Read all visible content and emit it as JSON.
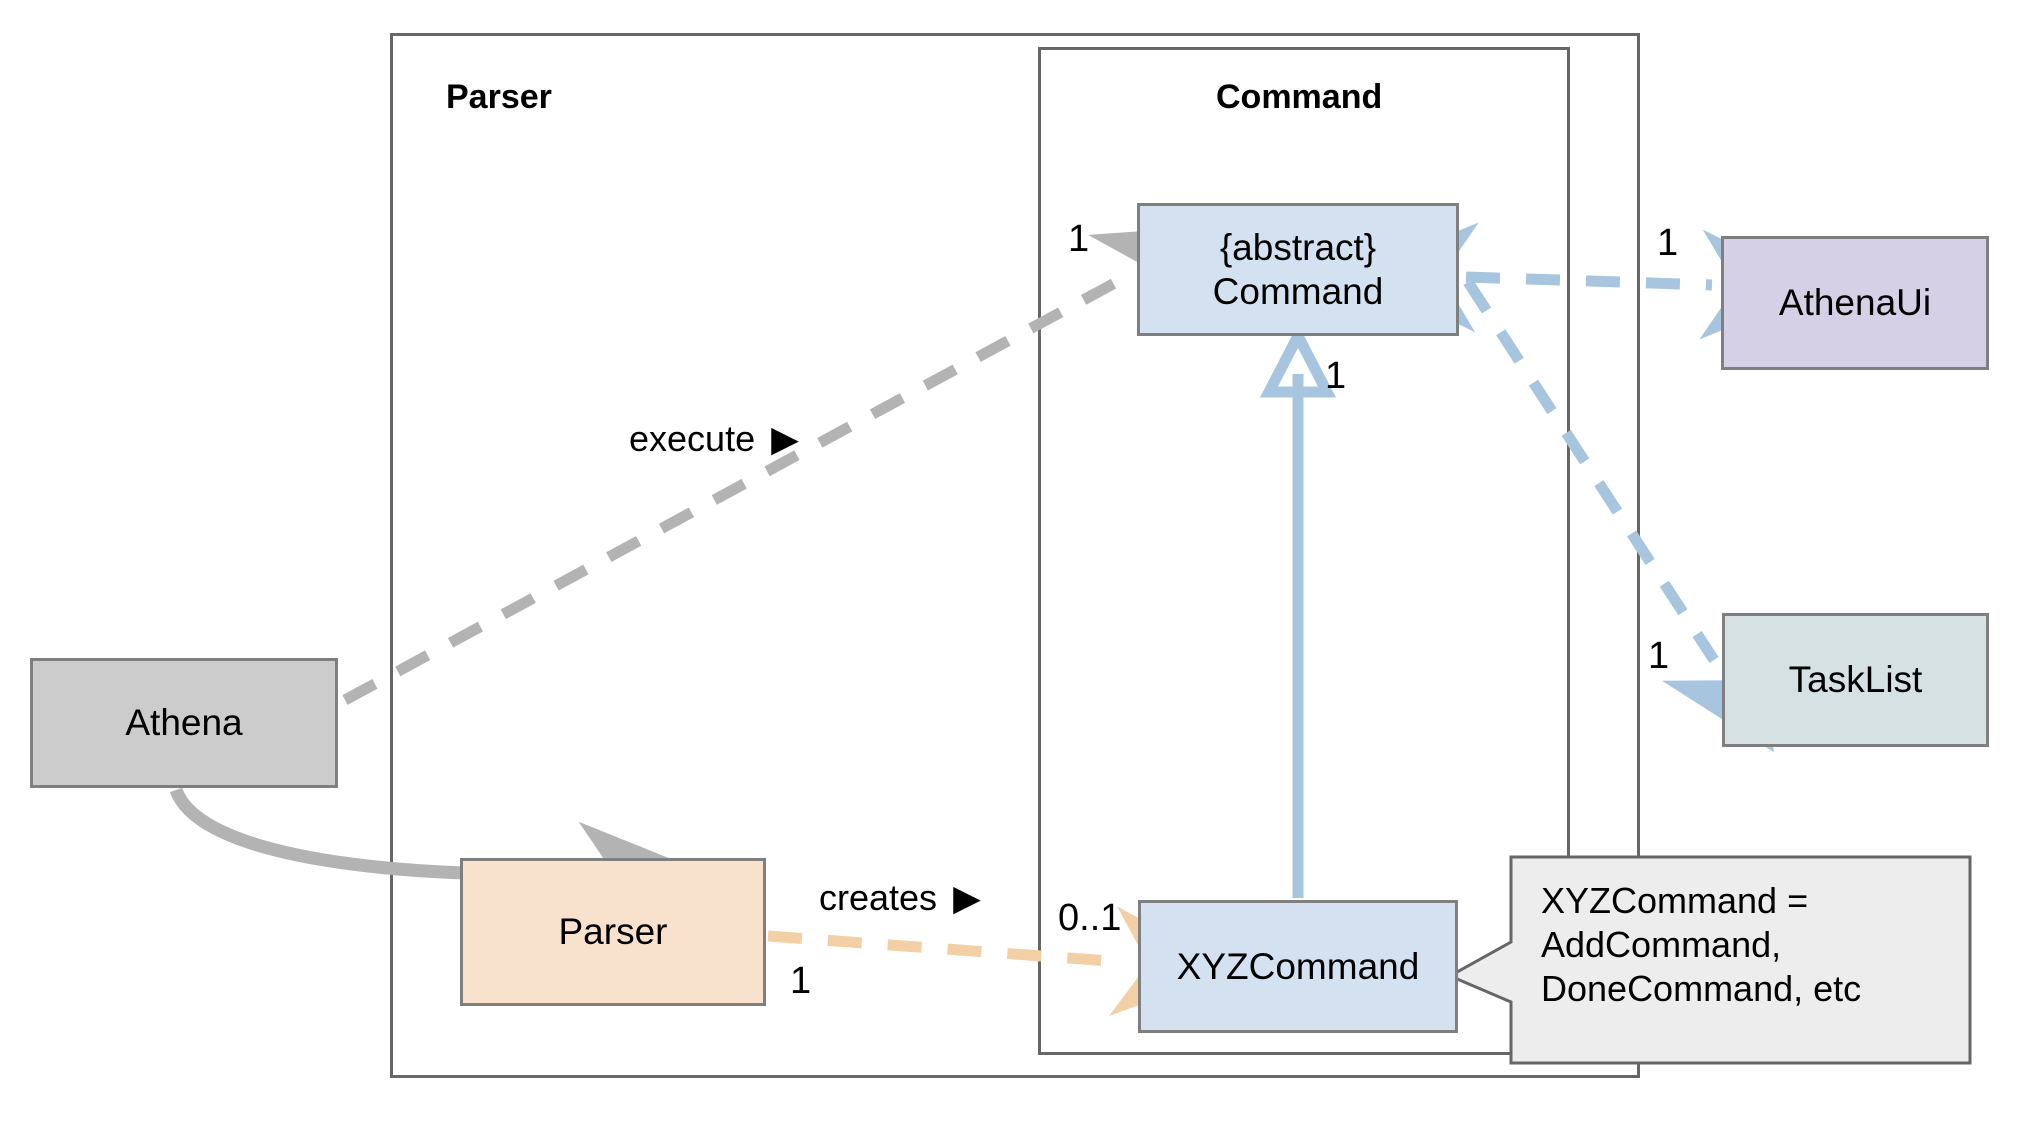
{
  "diagram": {
    "type": "uml-class-diagram",
    "packages": [
      {
        "id": "parser-pkg",
        "title": "Parser"
      },
      {
        "id": "command-pkg",
        "title": "Command"
      }
    ],
    "classes": [
      {
        "id": "athena",
        "label": "Athena",
        "color": "#cccccc"
      },
      {
        "id": "parser",
        "label": "Parser",
        "color": "#f9e2cd"
      },
      {
        "id": "command",
        "label": "{abstract}\nCommand",
        "line1": "{abstract}",
        "line2": "Command",
        "color": "#d4e1f0"
      },
      {
        "id": "xyzcommand",
        "label": "XYZCommand",
        "color": "#d4e1f0"
      },
      {
        "id": "athenaui",
        "label": "AthenaUi",
        "color": "#d5d0e5"
      },
      {
        "id": "tasklist",
        "label": "TaskList",
        "color": "#d6e1e4"
      }
    ],
    "note": {
      "id": "xyz-note",
      "text": "XYZCommand =\nAddCommand,\nDoneCommand, etc",
      "color": "#ededed"
    },
    "edge_labels": {
      "execute": "execute",
      "execute_marker": "▶",
      "creates": "creates",
      "creates_marker": "▶"
    },
    "multiplicities": {
      "athena_to_command": "1",
      "command_to_athenaui": "1",
      "command_to_tasklist": "1",
      "xyz_to_command": "1",
      "parser_creates_source": "1",
      "parser_creates_target": "0..1"
    },
    "colors": {
      "gray_edge": "#b3b3b3",
      "blue_edge": "#a8c5e0",
      "orange_edge": "#f3cfa5",
      "border": "#7f7f7f",
      "package_border": "#666666"
    }
  }
}
